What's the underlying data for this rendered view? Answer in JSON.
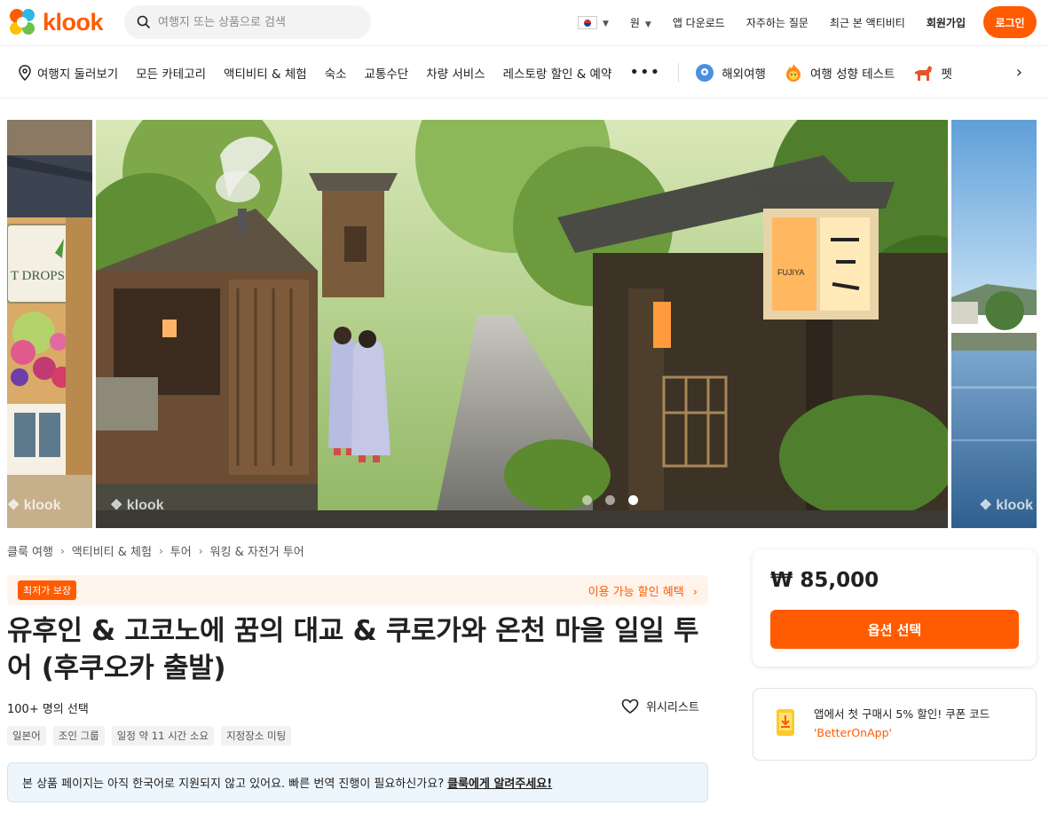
{
  "header": {
    "brand": "klook",
    "search_placeholder": "여행지 또는 상품으로 검색",
    "currency": "원",
    "app_download": "앱 다운로드",
    "faq": "자주하는 질문",
    "recently_viewed": "최근 본 액티비티",
    "signup": "회원가입",
    "login": "로그인"
  },
  "nav": {
    "items": [
      "여행지 둘러보기",
      "모든 카테고리",
      "액티비티 & 체험",
      "숙소",
      "교통수단",
      "차량 서비스",
      "레스토랑 할인 & 예약"
    ],
    "more": "•••",
    "extra": [
      "해외여행",
      "여행 성향 테스트",
      "펫"
    ]
  },
  "gallery": {
    "watermark": "klook",
    "dots": 3,
    "active_dot": 3,
    "sign_text": "T DROPS",
    "lantern_text": "FUJIYA"
  },
  "breadcrumb": [
    "클룩 여행",
    "액티비티 & 체험",
    "투어",
    "워킹 & 자전거 투어"
  ],
  "promo": {
    "badge": "최저가 보장",
    "link": "이용 가능 할인 혜택"
  },
  "product": {
    "title": "유후인 & 고코노에 꿈의 대교 & 쿠로가와 온천 마을 일일 투어 (후쿠오카 출발)",
    "booked": "100+ 명의 선택",
    "wishlist": "위시리스트",
    "tags": [
      "일본어",
      "조인 그룹",
      "일정 약 11 시간 소요",
      "지정장소 미팅"
    ]
  },
  "notice": {
    "text": "본 상품 페이지는 아직 한국어로 지원되지 않고 있어요. 빠른 번역 진행이 필요하신가요?",
    "link": "클룩에게 알려주세요!"
  },
  "price_card": {
    "price": "₩ 85,000",
    "button": "옵션 선택"
  },
  "coupon": {
    "text": "앱에서 첫 구매시 5% 할인! 쿠폰 코드",
    "code": "'BetterOnApp'"
  },
  "colors": {
    "accent": "#ff5b00",
    "notice_bg": "#eef6fd",
    "promo_bg": "#fff4ec"
  }
}
